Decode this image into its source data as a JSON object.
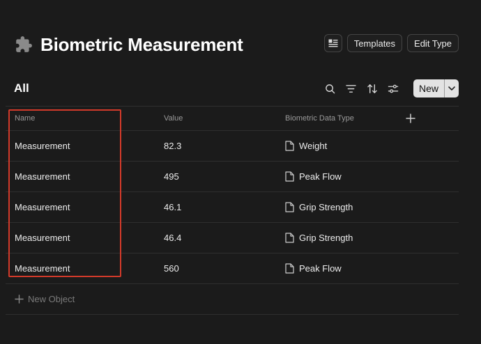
{
  "header": {
    "title": "Biometric Measurement",
    "type_icon": "puzzle-piece-icon",
    "layout_icon": "layout-icon",
    "templates_label": "Templates",
    "edit_type_label": "Edit Type"
  },
  "view": {
    "title": "All",
    "new_label": "New",
    "toolbar_icons": [
      "search-icon",
      "filter-icon",
      "sort-icon",
      "settings-sliders-icon",
      "chevron-down-icon"
    ]
  },
  "table": {
    "columns": [
      "Name",
      "Value",
      "Biometric Data Type"
    ],
    "rows": [
      {
        "name": "Measurement",
        "value": "82.3",
        "type": "Weight"
      },
      {
        "name": "Measurement",
        "value": "495",
        "type": "Peak Flow"
      },
      {
        "name": "Measurement",
        "value": "46.1",
        "type": "Grip Strength"
      },
      {
        "name": "Measurement",
        "value": "46.4",
        "type": "Grip Strength"
      },
      {
        "name": "Measurement",
        "value": "560",
        "type": "Peak Flow"
      }
    ],
    "new_object_label": "New Object"
  },
  "colors": {
    "background": "#1b1b1b",
    "highlight_border": "#d23a2a",
    "new_button_bg": "#e3e3e3"
  }
}
